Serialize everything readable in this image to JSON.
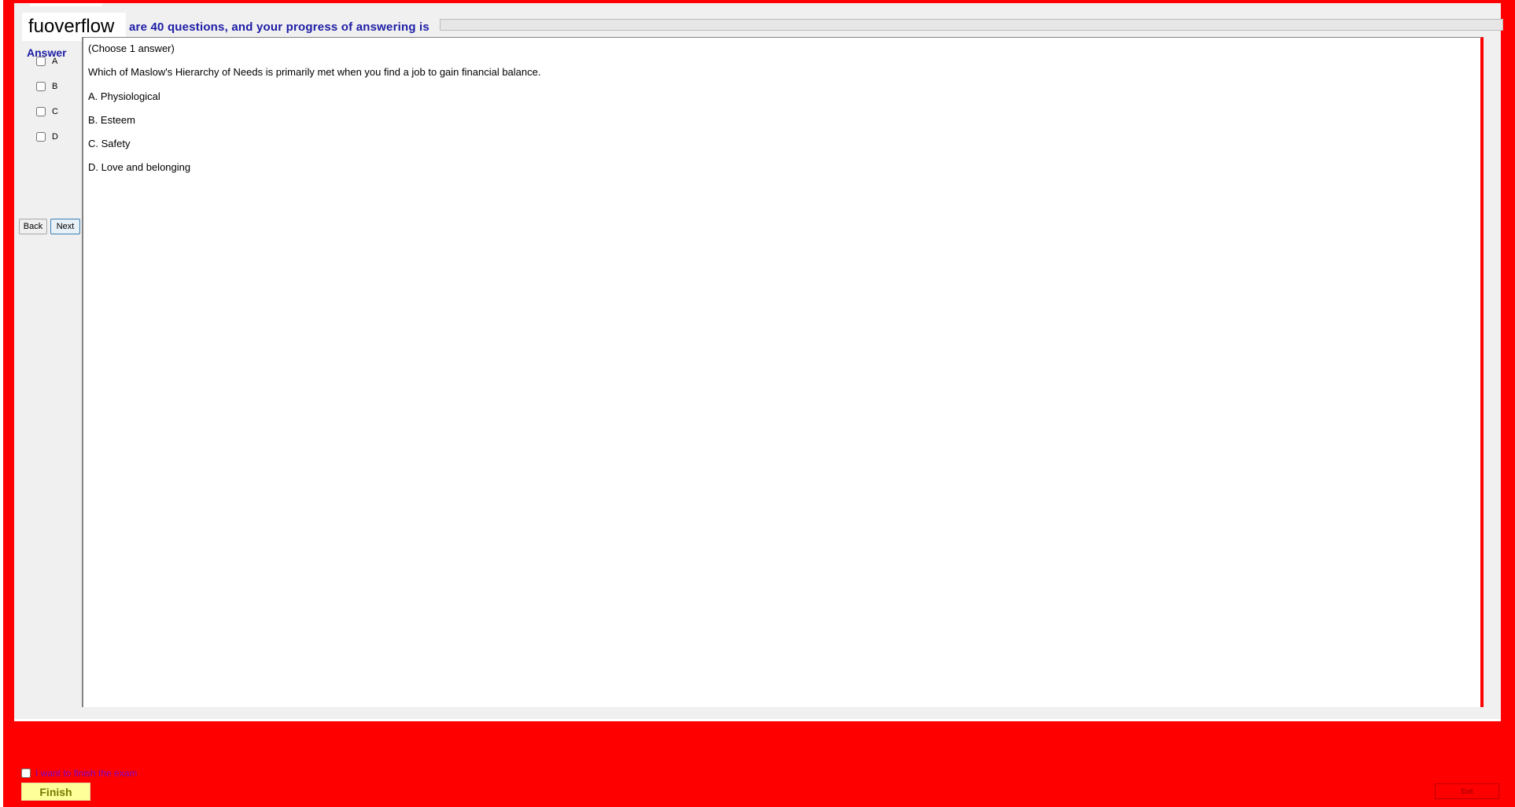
{
  "brand": "fuoverflow",
  "header": {
    "text": "are 40 questions, and your progress of answering is",
    "progress_percent": 0
  },
  "sidebar": {
    "title": "Answer",
    "options": [
      "A",
      "B",
      "C",
      "D"
    ],
    "back_label": "Back",
    "next_label": "Next"
  },
  "question": {
    "instruction": "(Choose 1 answer)",
    "text": "Which of Maslow's Hierarchy of Needs is primarily met when you find a job to gain financial balance.",
    "answers": [
      "A.  Physiological",
      "B.  Esteem",
      "C.  Safety",
      "D.  Love and belonging"
    ]
  },
  "footer": {
    "finish_checkbox_label": "I want to finish the exam",
    "finish_label": "Finish",
    "exit_label": "Exit"
  },
  "colors": {
    "background": "#ff0000",
    "accent_text": "#1c1ca6",
    "finish_button": "#ffff99"
  }
}
